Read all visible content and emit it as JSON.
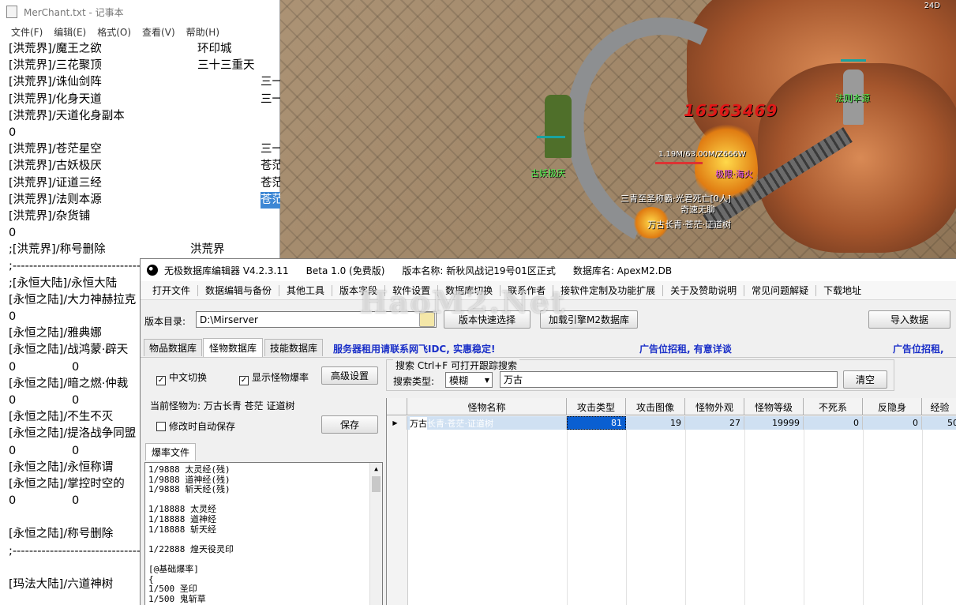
{
  "game": {
    "fps": "24D",
    "damage": "16563469",
    "npc_left": "古妖极厌",
    "npc_right": "法则本源",
    "hp_text": "1.19M/63.00M/Z666W",
    "player_tag": "极限·海火",
    "guild_line": "三青至圣称霸·光君死亡[0人]",
    "player_title": "奇速无聊",
    "monster_name": "万古长青·苍茫·证道树"
  },
  "notepad": {
    "title": "MerChant.txt - 记事本",
    "menu": [
      "文件(F)",
      "编辑(E)",
      "格式(O)",
      "查看(V)",
      "帮助(H)"
    ],
    "lines": [
      {
        "a": "[洪荒界]/魔王之欲",
        "b": "环印城"
      },
      {
        "a": "[洪荒界]/三花聚顶",
        "b": "三十三重天"
      },
      {
        "a": "[洪荒界]/诛仙剑阵",
        "b": "三一"
      },
      {
        "a": "[洪荒界]/化身天道",
        "b": "三一"
      },
      {
        "a": "[洪荒界]/天道化身副本",
        "b": ""
      },
      {
        "a": "0",
        "b": ""
      },
      {
        "a": "[洪荒界]/苍茫星空",
        "b": "三一"
      },
      {
        "a": "[洪荒界]/古妖极厌",
        "b": "苍茫"
      },
      {
        "a": "[洪荒界]/证道三经",
        "b": "苍茫"
      },
      {
        "a": "[洪荒界]/法则本源",
        "b": "苍茫"
      },
      {
        "a": "[洪荒界]/杂货铺",
        "b": ""
      },
      {
        "a": "0",
        "b": ""
      },
      {
        "a": ";[洪荒界]/称号删除",
        "b": "洪荒界"
      },
      {
        "a": ";-----------------------------------",
        "b": ""
      },
      {
        "a": ";[永恒大陆]/永恒大陆",
        "b": ""
      },
      {
        "a": "[永恒之陆]/大力神赫拉克",
        "b": ""
      },
      {
        "a": "0",
        "b": ""
      },
      {
        "a": "[永恒之陆]/雅典娜",
        "b": ""
      },
      {
        "a": "[永恒之陆]/战鸿蒙·辟天",
        "b": ""
      },
      {
        "a": "0",
        "b": "0"
      },
      {
        "a": "[永恒之陆]/暗之燃·仲裁",
        "b": ""
      },
      {
        "a": "0",
        "b": "0"
      },
      {
        "a": "[永恒之陆]/不生不灭",
        "b": ""
      },
      {
        "a": "[永恒之陆]/提洛战争同盟",
        "b": ""
      },
      {
        "a": "0",
        "b": "0"
      },
      {
        "a": "[永恒之陆]/永恒称谓",
        "b": ""
      },
      {
        "a": "[永恒之陆]/掌控时空的",
        "b": ""
      },
      {
        "a": "0",
        "b": "0"
      },
      {
        "a": "",
        "b": ""
      },
      {
        "a": "[永恒之陆]/称号删除",
        "b": ""
      },
      {
        "a": ";-----------------------------------",
        "b": ""
      },
      {
        "a": "",
        "b": ""
      },
      {
        "a": "[玛法大陆]/六道神树",
        "b": ""
      }
    ]
  },
  "editor": {
    "title_parts": [
      "无极数据库编辑器 V4.2.3.11",
      "Beta 1.0 (免费版)",
      "版本名称: 新秋风战记19号01区正式",
      "数据库名: ApexM2.DB"
    ],
    "menu": [
      "打开文件",
      "数据编辑与备份",
      "其他工具",
      "版本字段",
      "软件设置",
      "数据库切换",
      "联系作者",
      "接软件定制及功能扩展",
      "关于及赞助说明",
      "常见问题解疑",
      "下载地址"
    ],
    "dir_label": "版本目录:",
    "dir_value": "D:\\Mirserver",
    "btn_quick": "版本快速选择",
    "btn_load": "加载引擎M2数据库",
    "btn_import": "导入数据",
    "tabs": [
      "物品数据库",
      "怪物数据库",
      "技能数据库"
    ],
    "ad1": "服务器租用请联系网飞IDC, 实惠稳定!",
    "ad2": "广告位招租, 有意详谈",
    "ad3": "广告位招租,",
    "chk_chinese": "中文切换",
    "chk_droprate": "显示怪物爆率",
    "btn_advanced": "高级设置",
    "current_monster": "当前怪物为: 万古长青 苍茫 证道树",
    "chk_autosave": "修改时自动保存",
    "btn_save": "保存",
    "droptab": "爆率文件",
    "droplist": "1/9888 太灵经(残)\n1/9888 道神经(残)\n1/9888 斩天经(残)\n\n1/18888 太灵经\n1/18888 道神经\n1/18888 斩天经\n\n1/22888 煌天役灵印\n\n[@基础爆率]\n{\n1/500 圣印\n1/500 鬼斩草",
    "search_title": "搜索  Ctrl+F 可打开跟踪搜索",
    "search_type_label": "搜索类型:",
    "search_type_value": "模糊",
    "search_value": "万古",
    "btn_clear": "清空",
    "columns": [
      "怪物名称",
      "攻击类型",
      "攻击图像",
      "怪物外观",
      "怪物等级",
      "不死系",
      "反隐身",
      "经验"
    ],
    "row": {
      "name_hl": "万古",
      "name_rest": "长青·苍茫·证道树",
      "attack_type": "81",
      "attack_img": "19",
      "appearance": "27",
      "level": "19999",
      "undead": "0",
      "anti_invis": "0",
      "exp": "50"
    }
  },
  "watermark": "HaoM2.Net"
}
